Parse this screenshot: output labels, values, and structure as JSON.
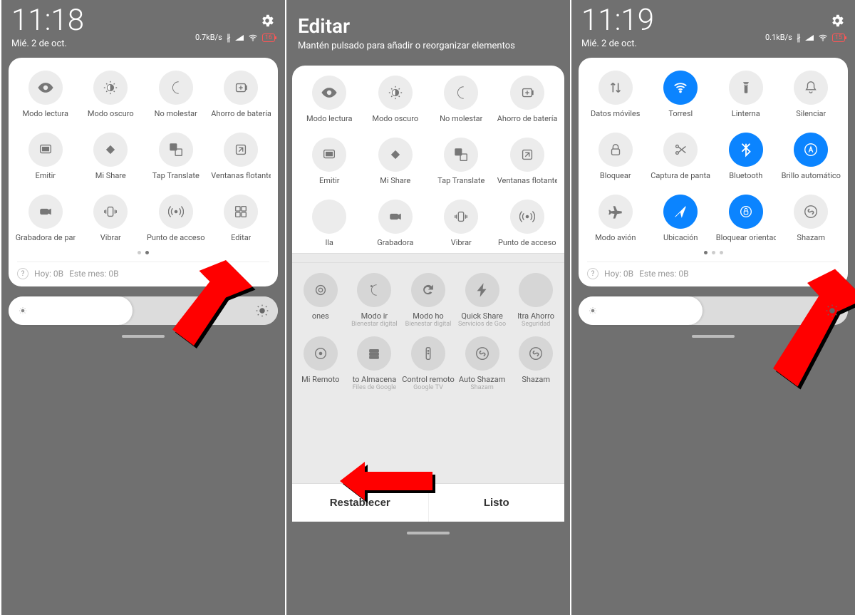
{
  "phone1": {
    "time": "11:18",
    "date": "Mié. 2 de oct.",
    "net_speed": "0.7kB/s",
    "battery": "16",
    "tiles": [
      {
        "label": "Modo lectura",
        "icon": "eye"
      },
      {
        "label": "Modo oscuro",
        "icon": "darkmode"
      },
      {
        "label": "No molestar",
        "icon": "moon"
      },
      {
        "label": "Ahorro de batería",
        "icon": "battery-plus"
      },
      {
        "label": "Emitir",
        "icon": "cast"
      },
      {
        "label": "Mi Share",
        "icon": "share"
      },
      {
        "label": "Tap Translate",
        "icon": "translate"
      },
      {
        "label": "Ventanas flotantes",
        "icon": "float"
      },
      {
        "label": "Grabadora de pantalla",
        "icon": "camcorder"
      },
      {
        "label": "Vibrar",
        "icon": "vibrate"
      },
      {
        "label": "Punto de acceso",
        "icon": "hotspot"
      },
      {
        "label": "Editar",
        "icon": "grid"
      }
    ],
    "usage_today": "Hoy: 0B",
    "usage_month": "Este mes: 0B"
  },
  "phone2": {
    "title": "Editar",
    "subtitle": "Mantén pulsado para añadir o reorganizar elementos",
    "active_tiles": [
      {
        "label": "Modo lectura",
        "icon": "eye"
      },
      {
        "label": "Modo oscuro",
        "icon": "darkmode"
      },
      {
        "label": "No molestar",
        "icon": "moon"
      },
      {
        "label": "Ahorro de batería",
        "icon": "battery-plus"
      },
      {
        "label": "Emitir",
        "icon": "cast"
      },
      {
        "label": "Mi Share",
        "icon": "share"
      },
      {
        "label": "Tap Translate",
        "icon": "translate"
      },
      {
        "label": "Ventanas flotantes",
        "icon": "float"
      },
      {
        "label": "lla",
        "icon": "blank"
      },
      {
        "label": "Grabadora",
        "icon": "camcorder"
      },
      {
        "label": "Vibrar",
        "icon": "vibrate"
      },
      {
        "label": "Punto de acceso",
        "icon": "hotspot"
      }
    ],
    "inactive_tiles": [
      {
        "label": "ones",
        "sub": "",
        "icon": "dual"
      },
      {
        "label": "Modo ir",
        "sub": "Bienestar digital",
        "icon": "nightmode"
      },
      {
        "label": "Modo ho",
        "sub": "Bienestar digital",
        "icon": "refresh"
      },
      {
        "label": "Quick Share",
        "sub": "Servicios de Goo",
        "icon": "bolt"
      },
      {
        "label": "ltra Ahorro",
        "sub": "Seguridad",
        "icon": "blank2",
        "phantom": true
      },
      {
        "label": "Mi Remoto",
        "sub": "",
        "icon": "remote-dot"
      },
      {
        "label": "to Almacena",
        "sub": "Files de Google",
        "icon": "storage"
      },
      {
        "label": "Control remoto",
        "sub": "Google TV",
        "icon": "remote"
      },
      {
        "label": "Auto Shazam",
        "sub": "Shazam",
        "icon": "shazam"
      },
      {
        "label": "Shazam",
        "sub": "",
        "icon": "shazam"
      }
    ],
    "reset": "Restablecer",
    "done": "Listo"
  },
  "phone3": {
    "time": "11:19",
    "date": "Mié. 2 de oct.",
    "net_speed": "0.1kB/s",
    "battery": "15",
    "tiles": [
      {
        "label": "Datos móviles",
        "icon": "data",
        "active": false
      },
      {
        "label": "Torresl",
        "icon": "wifi",
        "active": true
      },
      {
        "label": "Linterna",
        "icon": "torch",
        "active": false
      },
      {
        "label": "Silenciar",
        "icon": "bell",
        "active": false
      },
      {
        "label": "Bloquear",
        "icon": "lock",
        "active": false
      },
      {
        "label": "Captura de pantalla",
        "icon": "scissors",
        "active": false
      },
      {
        "label": "Bluetooth",
        "icon": "bluetooth",
        "active": true
      },
      {
        "label": "Brillo automático",
        "icon": "auto-bright",
        "active": true
      },
      {
        "label": "Modo avión",
        "icon": "plane",
        "active": false
      },
      {
        "label": "Ubicación",
        "icon": "location",
        "active": true
      },
      {
        "label": "Bloquear orientación",
        "icon": "rotate-lock",
        "active": true
      },
      {
        "label": "Shazam",
        "icon": "shazam",
        "active": false
      }
    ],
    "usage_today": "Hoy: 0B",
    "usage_month": "Este mes: 0B"
  }
}
